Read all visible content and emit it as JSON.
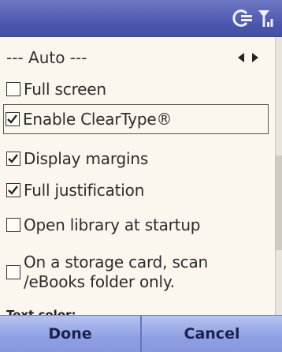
{
  "status_bar": {
    "icons": [
      "connectivity-icon",
      "signal-strength-icon"
    ]
  },
  "selector": {
    "value": "--- Auto ---"
  },
  "options": [
    {
      "label": "Full screen",
      "checked": false,
      "focused": false
    },
    {
      "label": "Enable ClearType®",
      "checked": true,
      "focused": true
    },
    {
      "label": "Display margins",
      "checked": true,
      "focused": false
    },
    {
      "label": "Full justification",
      "checked": true,
      "focused": false
    },
    {
      "label": "Open library at startup",
      "checked": false,
      "focused": false
    },
    {
      "label": "On a storage card, scan /eBooks folder only.",
      "checked": false,
      "focused": false
    }
  ],
  "section_partial": "Text color:",
  "softkeys": {
    "left": "Done",
    "right": "Cancel"
  },
  "colors": {
    "title_bar": "#4b55ad",
    "softkey_bar": "#8f9fe2",
    "background": "#fbf6ee"
  }
}
